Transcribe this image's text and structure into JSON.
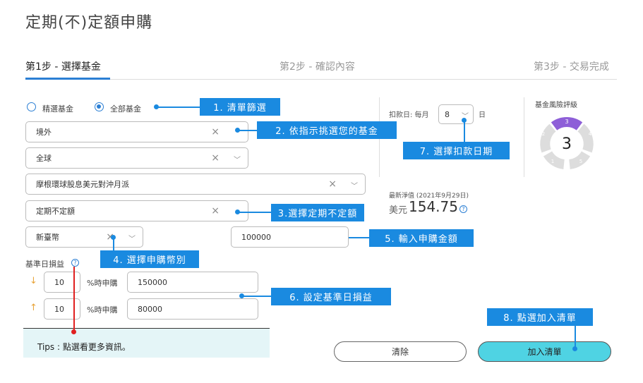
{
  "page_title": "定期(不)定額申購",
  "steps": [
    {
      "label": "第1步 - 選擇基金"
    },
    {
      "label": "第2步 - 確認內容"
    },
    {
      "label": "第3步 - 交易完成"
    }
  ],
  "filter": {
    "option_selected": "精選基金",
    "option_all": "全部基金"
  },
  "fields": {
    "region": "境外",
    "market": "全球",
    "fund": "摩根環球股息美元對沖月派",
    "plan_type": "定期不定額",
    "currency": "新臺幣",
    "amount": "100000"
  },
  "debit": {
    "label": "扣款日: 每月",
    "day": "8",
    "suffix": "日"
  },
  "nav": {
    "label": "最新淨值 (2021年9月29日)",
    "currency": "美元",
    "value": "154.75"
  },
  "risk": {
    "title": "基金風險評級",
    "level": "3",
    "segments": [
      "1",
      "2",
      "3",
      "4",
      "5"
    ]
  },
  "pl": {
    "label": "基準日損益",
    "rows": [
      {
        "pct": "10",
        "unit": "%時申購",
        "amount": "150000"
      },
      {
        "pct": "10",
        "unit": "%時申購",
        "amount": "80000"
      }
    ]
  },
  "tips": {
    "text": "Tips :  點選看更多資訊。"
  },
  "buttons": {
    "clear": "清除",
    "add": "加入清單"
  },
  "callouts": {
    "c1": "1. 清單篩選",
    "c2": "2. 依指示挑選您的基金",
    "c3": "3.選擇定期不定額",
    "c4": "4. 選擇申購幣別",
    "c5": "5. 輸入申購金額",
    "c6": "6. 設定基準日損益",
    "c7": "7. 選擇扣款日期",
    "c8": "8. 點選加入清單"
  },
  "colors": {
    "accent": "#1a8ae0",
    "risk_active": "#8e5fd8",
    "risk_inactive": "#dddddd",
    "add_button": "#4fd3e3"
  }
}
